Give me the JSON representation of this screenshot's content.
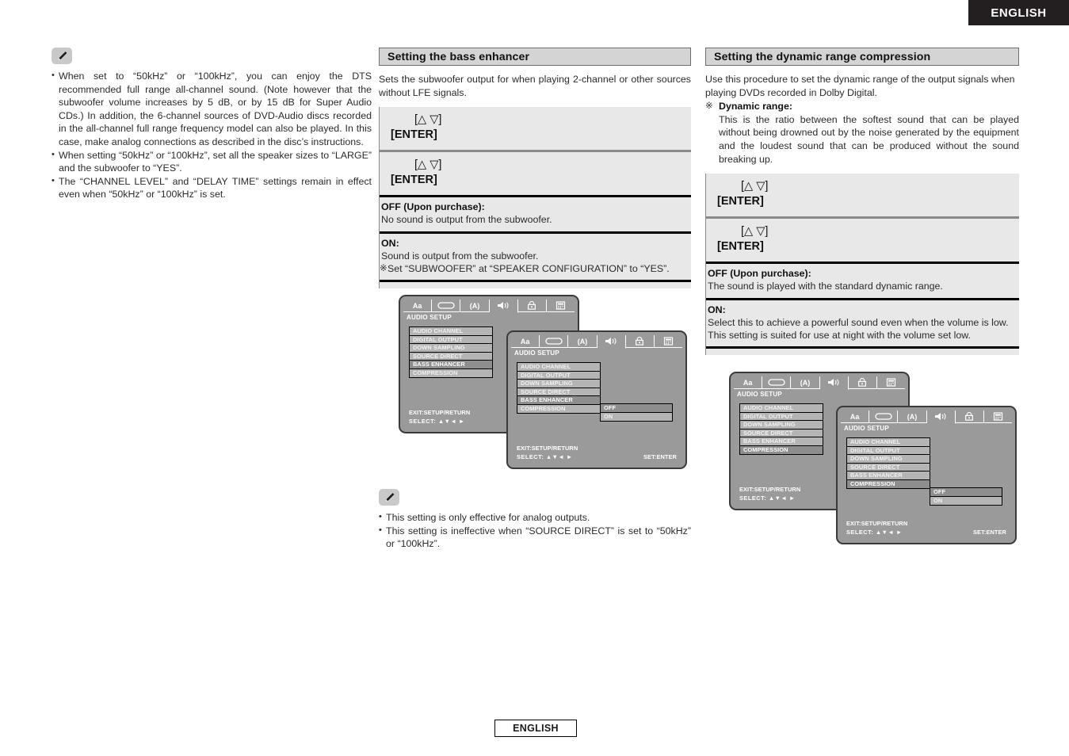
{
  "banner": {
    "language": "ENGLISH"
  },
  "footer": {
    "language": "ENGLISH"
  },
  "left_column": {
    "note_icon": "pencil-note-icon",
    "bullets": [
      "When set to “50kHz” or “100kHz”, you can enjoy the DTS recommended full range all-channel sound. (Note however that the subwoofer volume increases by 5 dB, or by 15 dB for Super Audio CDs.) In addition, the 6-channel sources of DVD-Audio discs recorded in the all-channel full range frequency model can also be played. In this case, make analog connections as described in the disc’s instructions.",
      "When setting “50kHz” or “100kHz”, set all the speaker sizes to “LARGE” and the subwoofer to “YES”.",
      "The “CHANNEL LEVEL” and “DELAY TIME” settings remain in effect even when “50kHz” or “100kHz” is set."
    ]
  },
  "middle_column": {
    "heading": "Setting the bass enhancer",
    "intro": "Sets the subwoofer output for when playing 2-channel or other sources without LFE signals.",
    "steps": [
      {
        "arrows": "[△ ▽]",
        "enter": "[ENTER]"
      },
      {
        "arrows": "[△  ▽]",
        "enter": "[ENTER]"
      }
    ],
    "options": [
      {
        "title": "OFF (Upon purchase):",
        "lines": [
          "No sound is output from the subwoofer."
        ],
        "sub": null
      },
      {
        "title": "ON:",
        "lines": [
          "Sound is output from the subwoofer."
        ],
        "sub": "Set “SUBWOOFER” at “SPEAKER CONFIGURATION” to “YES”."
      }
    ],
    "note_icon": "pencil-note-icon",
    "notes": [
      "This setting is only effective for analog outputs.",
      "This setting is ineffective when “SOURCE DIRECT” is set to “50kHz” or “100kHz”."
    ],
    "osd": {
      "screen_1": {
        "title": "AUDIO SETUP",
        "tabs": [
          "Aa",
          "disc-icon",
          "(A)",
          "speaker-icon",
          "lock-icon",
          "display-icon"
        ],
        "active_tab_index": 3,
        "menu": [
          "AUDIO CHANNEL",
          "DIGITAL OUTPUT",
          "DOWN SAMPLING",
          "SOURCE DIRECT",
          "BASS ENHANCER",
          "COMPRESSION"
        ],
        "selected_index": 4,
        "foot_exit": "EXIT:SETUP/RETURN",
        "foot_select": "SELECT: ▲▼◄ ►",
        "foot_set": "SET:ENTER"
      },
      "screen_2": {
        "title": "AUDIO SETUP",
        "tabs": [
          "Aa",
          "disc-icon",
          "(A)",
          "speaker-icon",
          "lock-icon",
          "display-icon"
        ],
        "active_tab_index": 3,
        "menu": [
          "AUDIO CHANNEL",
          "DIGITAL OUTPUT",
          "DOWN SAMPLING",
          "SOURCE DIRECT",
          "BASS ENHANCER",
          "COMPRESSION"
        ],
        "selected_index": 4,
        "values": [
          "OFF",
          "ON"
        ],
        "value_highlight_index": 0,
        "foot_exit": "EXIT:SETUP/RETURN",
        "foot_select": "SELECT: ▲▼◄ ►",
        "foot_set": "SET:ENTER"
      }
    }
  },
  "right_column": {
    "heading": "Setting the dynamic range compression",
    "intro": "Use this procedure to set the dynamic range of the output signals when playing DVDs recorded in Dolby Digital.",
    "x_note": {
      "mark": "※",
      "title": "Dynamic range:",
      "body": "This is the ratio between the softest sound that can be played without being drowned out by the noise generated by the equipment and the loudest sound that can be produced without the sound breaking up."
    },
    "steps": [
      {
        "arrows": "[△ ▽]",
        "enter": "[ENTER]"
      },
      {
        "arrows": "[△  ▽]",
        "enter": "[ENTER]"
      }
    ],
    "options": [
      {
        "title": "OFF (Upon purchase):",
        "lines": [
          "The sound is played with the standard dynamic range."
        ],
        "sub": null
      },
      {
        "title": "ON:",
        "lines": [
          "Select this to achieve a powerful sound even when the volume is low.",
          "This setting is suited for use at night with the volume set low."
        ],
        "sub": null
      }
    ],
    "osd": {
      "screen_1": {
        "title": "AUDIO SETUP",
        "tabs": [
          "Aa",
          "disc-icon",
          "(A)",
          "speaker-icon",
          "lock-icon",
          "display-icon"
        ],
        "active_tab_index": 3,
        "menu": [
          "AUDIO CHANNEL",
          "DIGITAL OUTPUT",
          "DOWN SAMPLING",
          "SOURCE DIRECT",
          "BASS ENHANCER",
          "COMPRESSION"
        ],
        "selected_index": 5,
        "foot_exit": "EXIT:SETUP/RETURN",
        "foot_select": "SELECT: ▲▼◄ ►",
        "foot_set": "SET:ENTER"
      },
      "screen_2": {
        "title": "AUDIO SETUP",
        "tabs": [
          "Aa",
          "disc-icon",
          "(A)",
          "speaker-icon",
          "lock-icon",
          "display-icon"
        ],
        "active_tab_index": 3,
        "menu": [
          "AUDIO CHANNEL",
          "DIGITAL OUTPUT",
          "DOWN SAMPLING",
          "SOURCE DIRECT",
          "BASS ENHANCER",
          "COMPRESSION"
        ],
        "selected_index": 5,
        "values": [
          "OFF",
          "ON"
        ],
        "value_highlight_index": 0,
        "foot_exit": "EXIT:SETUP/RETURN",
        "foot_select": "SELECT: ▲▼◄ ►",
        "foot_set": "SET:ENTER"
      }
    }
  },
  "colors": {
    "banner_bg": "#231f20",
    "heading_bg": "#d4d4d4",
    "panel_bg": "#e8e8e8",
    "osd_bg": "#9a9a9a",
    "osd_row": "#b4b4b4",
    "osd_row_selected": "#8e8e8e"
  }
}
